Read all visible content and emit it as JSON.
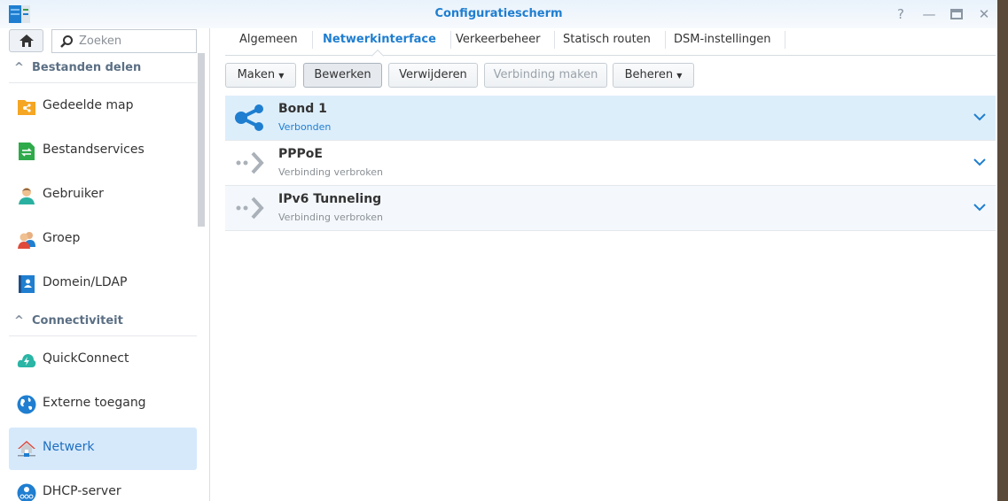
{
  "window": {
    "title": "Configuratiescherm",
    "controls": [
      "help",
      "minimize",
      "maximize",
      "close"
    ]
  },
  "sidebar": {
    "search_placeholder": "Zoeken",
    "sections": [
      {
        "label": "Bestanden delen",
        "items": [
          {
            "label": "Gedeelde map",
            "icon": "shared-folder-icon"
          },
          {
            "label": "Bestandservices",
            "icon": "file-services-icon"
          },
          {
            "label": "Gebruiker",
            "icon": "user-icon"
          },
          {
            "label": "Groep",
            "icon": "group-icon"
          },
          {
            "label": "Domein/LDAP",
            "icon": "domain-ldap-icon"
          }
        ]
      },
      {
        "label": "Connectiviteit",
        "items": [
          {
            "label": "QuickConnect",
            "icon": "quickconnect-icon"
          },
          {
            "label": "Externe toegang",
            "icon": "globe-icon"
          },
          {
            "label": "Netwerk",
            "icon": "network-home-icon",
            "selected": true
          },
          {
            "label": "DHCP-server",
            "icon": "dhcp-icon"
          }
        ]
      }
    ]
  },
  "tabs": [
    "Algemeen",
    "Netwerkinterface",
    "Verkeerbeheer",
    "Statisch routen",
    "DSM-instellingen"
  ],
  "active_tab": "Netwerkinterface",
  "toolbar": {
    "create": "Maken",
    "edit": "Bewerken",
    "delete": "Verwijderen",
    "connect": "Verbinding maken",
    "manage": "Beheren"
  },
  "interfaces": [
    {
      "name": "Bond 1",
      "status": "Verbonden",
      "connected": true
    },
    {
      "name": "PPPoE",
      "status": "Verbinding verbroken",
      "connected": false
    },
    {
      "name": "IPv6 Tunneling",
      "status": "Verbinding verbroken",
      "connected": false
    }
  ],
  "colors": {
    "accent": "#1f7ed0",
    "selected_bg": "#d6e9fb"
  }
}
